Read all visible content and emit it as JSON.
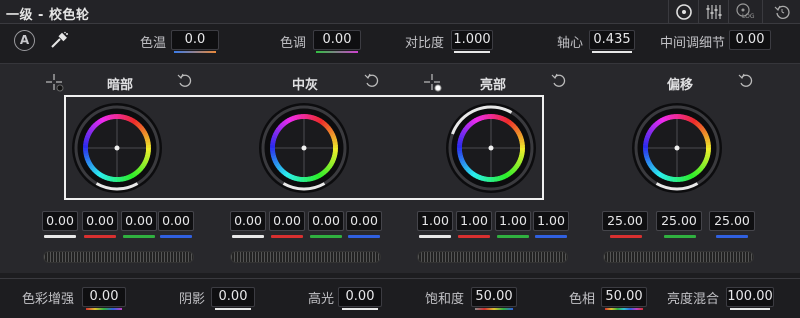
{
  "header": {
    "title": "一级 - 校色轮"
  },
  "toolbar": {
    "icons": [
      "wheels-mode-icon",
      "bars-mode-icon",
      "log-mode-icon",
      "reset-all-icon"
    ],
    "log_label": "LOG"
  },
  "top_params": {
    "auto_label": "A",
    "temperature": {
      "label": "色温",
      "value": "0.0"
    },
    "tint": {
      "label": "色调",
      "value": "0.00"
    },
    "contrast": {
      "label": "对比度",
      "value": "1.000"
    },
    "pivot": {
      "label": "轴心",
      "value": "0.435"
    },
    "midtone_detail": {
      "label": "中间调细节",
      "value": "0.00"
    }
  },
  "wheels": [
    {
      "name": "暗部",
      "values": [
        "0.00",
        "0.00",
        "0.00",
        "0.00"
      ]
    },
    {
      "name": "中灰",
      "values": [
        "0.00",
        "0.00",
        "0.00",
        "0.00"
      ]
    },
    {
      "name": "亮部",
      "values": [
        "1.00",
        "1.00",
        "1.00",
        "1.00"
      ]
    },
    {
      "name": "偏移",
      "values": [
        "25.00",
        "25.00",
        "25.00"
      ]
    }
  ],
  "bottom_params": {
    "color_boost": {
      "label": "色彩增强",
      "value": "0.00"
    },
    "shadows": {
      "label": "阴影",
      "value": "0.00"
    },
    "highlights": {
      "label": "高光",
      "value": "0.00"
    },
    "saturation": {
      "label": "饱和度",
      "value": "50.00"
    },
    "hue": {
      "label": "色相",
      "value": "50.00"
    },
    "lum_mix": {
      "label": "亮度混合",
      "value": "100.00"
    }
  },
  "colors": {
    "white": "#e8e8e8",
    "red": "#d83030",
    "green": "#30b040",
    "blue": "#3060e0",
    "selection": "#f0f0f0"
  }
}
